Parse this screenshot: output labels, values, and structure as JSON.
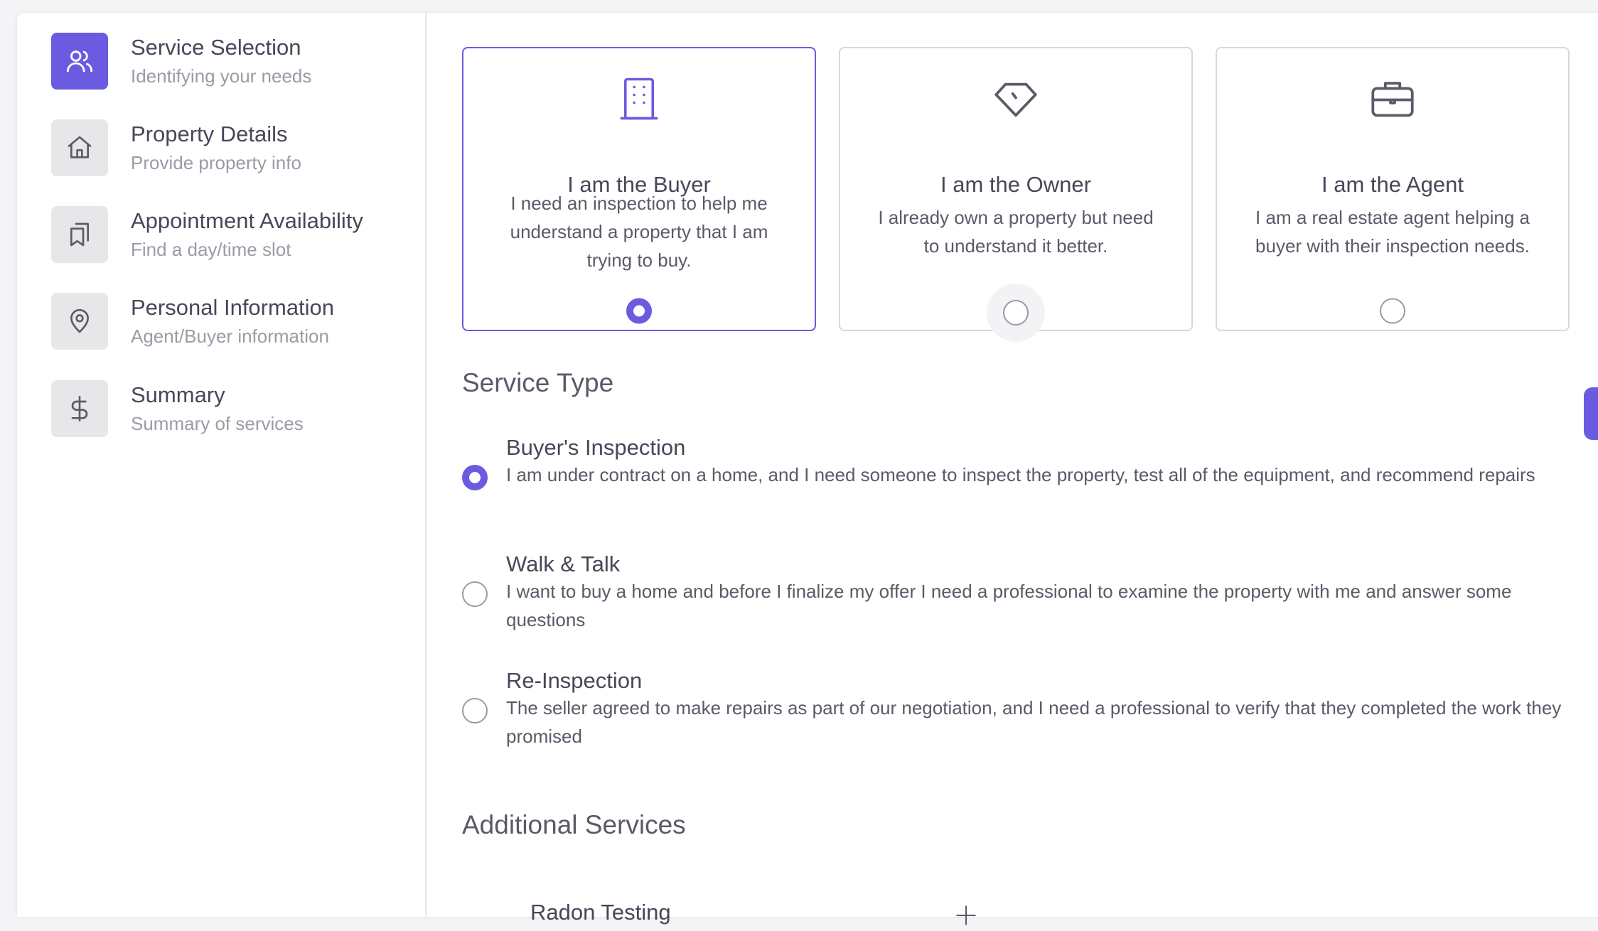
{
  "steps": [
    {
      "title": "Service Selection",
      "subtitle": "Identifying your needs",
      "icon": "users-icon",
      "active": true
    },
    {
      "title": "Property Details",
      "subtitle": "Provide property info",
      "icon": "home-icon",
      "active": false
    },
    {
      "title": "Appointment Availability",
      "subtitle": "Find a day/time slot",
      "icon": "bookmarks-icon",
      "active": false
    },
    {
      "title": "Personal Information",
      "subtitle": "Agent/Buyer information",
      "icon": "map-pin-icon",
      "active": false
    },
    {
      "title": "Summary",
      "subtitle": "Summary of services",
      "icon": "dollar-icon",
      "active": false
    }
  ],
  "roles": [
    {
      "title": "I am the Buyer",
      "description": "I need an inspection to help me understand a property that I am trying to buy.",
      "icon": "building-icon",
      "selected": true
    },
    {
      "title": "I am the Owner",
      "description": "I already own a property but need to understand it better.",
      "icon": "diamond-tag-icon",
      "selected": false
    },
    {
      "title": "I am the Agent",
      "description": "I am a real estate agent helping a buyer with their inspection needs.",
      "icon": "briefcase-icon",
      "selected": false
    }
  ],
  "service_type": {
    "heading": "Service Type",
    "options": [
      {
        "title": "Buyer's Inspection",
        "description": "I am under contract on a home, and I need someone to inspect the property, test all of the equipment, and recommend repairs",
        "selected": true
      },
      {
        "title": "Walk & Talk",
        "description": "I want to buy a home and before I finalize my offer I need a professional to examine the property with me and answer some questions",
        "selected": false
      },
      {
        "title": "Re-Inspection",
        "description": "The seller agreed to make repairs as part of our negotiation, and I need a professional to verify that they completed the work they promised",
        "selected": false
      }
    ]
  },
  "additional_services": {
    "heading": "Additional Services",
    "items": [
      {
        "title": "Radon Testing",
        "icon": "plus-icon"
      }
    ]
  },
  "colors": {
    "accent": "#6b5be0",
    "inactive_icon_bg": "#e7e7ea",
    "text_primary": "#474758",
    "text_muted": "#9b9ba7"
  }
}
